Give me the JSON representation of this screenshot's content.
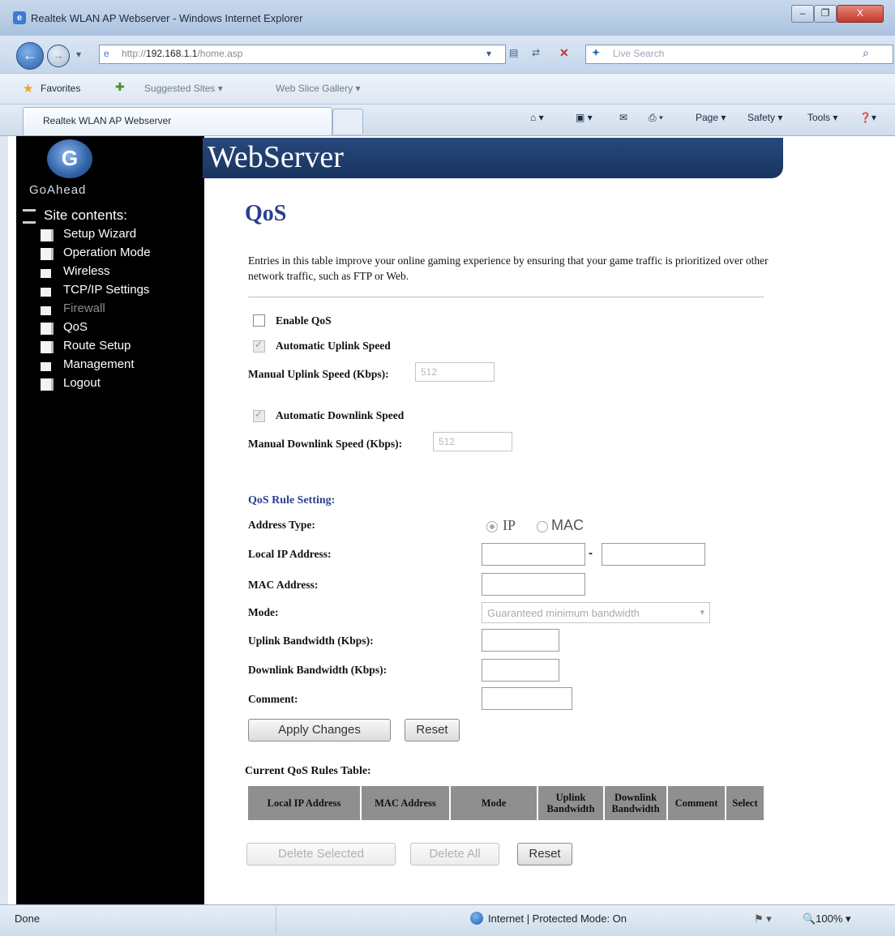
{
  "window": {
    "title": "Realtek WLAN AP Webserver - Windows Internet Explorer",
    "minimize": "–",
    "restore": "❐",
    "close": "X"
  },
  "browser": {
    "url_prefix": "http://",
    "url_host": "192.168.1.1",
    "url_path": "/home.asp",
    "search_placeholder": "Live Search",
    "favorites_label": "Favorites",
    "suggested_sites": "Suggested Sites ▾",
    "web_slice": "Web Slice Gallery ▾",
    "tab_title": "Realtek WLAN AP Webserver",
    "cmd_page": "Page ▾",
    "cmd_safety": "Safety ▾",
    "cmd_tools": "Tools ▾",
    "cmd_help": "❓▾"
  },
  "header": {
    "banner_title": "WebServer",
    "logo_text": "GoAhead"
  },
  "sidebar": {
    "heading": "Site contents:",
    "items": [
      {
        "label": "Setup Wizard",
        "icon": "document-icon"
      },
      {
        "label": "Operation Mode",
        "icon": "document-icon"
      },
      {
        "label": "Wireless",
        "icon": "folder-icon"
      },
      {
        "label": "TCP/IP Settings",
        "icon": "folder-icon"
      },
      {
        "label": "Firewall",
        "icon": "folder-icon"
      },
      {
        "label": "QoS",
        "icon": "document-icon"
      },
      {
        "label": "Route Setup",
        "icon": "document-icon"
      },
      {
        "label": "Management",
        "icon": "folder-icon"
      },
      {
        "label": "Logout",
        "icon": "document-icon"
      }
    ]
  },
  "main": {
    "title": "QoS",
    "intro": "Entries in this table improve your online gaming experience by ensuring that your game traffic is prioritized over other network traffic, such as FTP or Web.",
    "enable_qos": "Enable QoS",
    "auto_uplink": "Automatic Uplink Speed",
    "manual_uplink_label": "Manual Uplink Speed (Kbps):",
    "manual_uplink_value": "512",
    "auto_downlink": "Automatic Downlink Speed",
    "manual_downlink_label": "Manual Downlink Speed (Kbps):",
    "manual_downlink_value": "512",
    "rule_heading": "QoS Rule Setting:",
    "address_type_label": "Address Type:",
    "radio_ip": "IP",
    "radio_mac": "MAC",
    "local_ip_label": "Local IP Address:",
    "ip_range_dash": "-",
    "mac_label": "MAC Address:",
    "mode_label": "Mode:",
    "mode_value": "Guaranteed minimum bandwidth",
    "uplink_bw_label": "Uplink Bandwidth (Kbps):",
    "downlink_bw_label": "Downlink Bandwidth (Kbps):",
    "comment_label": "Comment:",
    "apply_button": "Apply Changes",
    "reset_button": "Reset",
    "table_title": "Current QoS Rules Table:",
    "table_headers": [
      "Local IP Address",
      "MAC Address",
      "Mode",
      "Uplink Bandwidth",
      "Downlink Bandwidth",
      "Comment",
      "Select"
    ],
    "delete_selected": "Delete Selected",
    "delete_all": "Delete All",
    "reset_table": "Reset"
  },
  "statusbar": {
    "status": "Done",
    "zone": "Internet | Protected Mode: On",
    "zoom": "🔍100% ▾"
  }
}
